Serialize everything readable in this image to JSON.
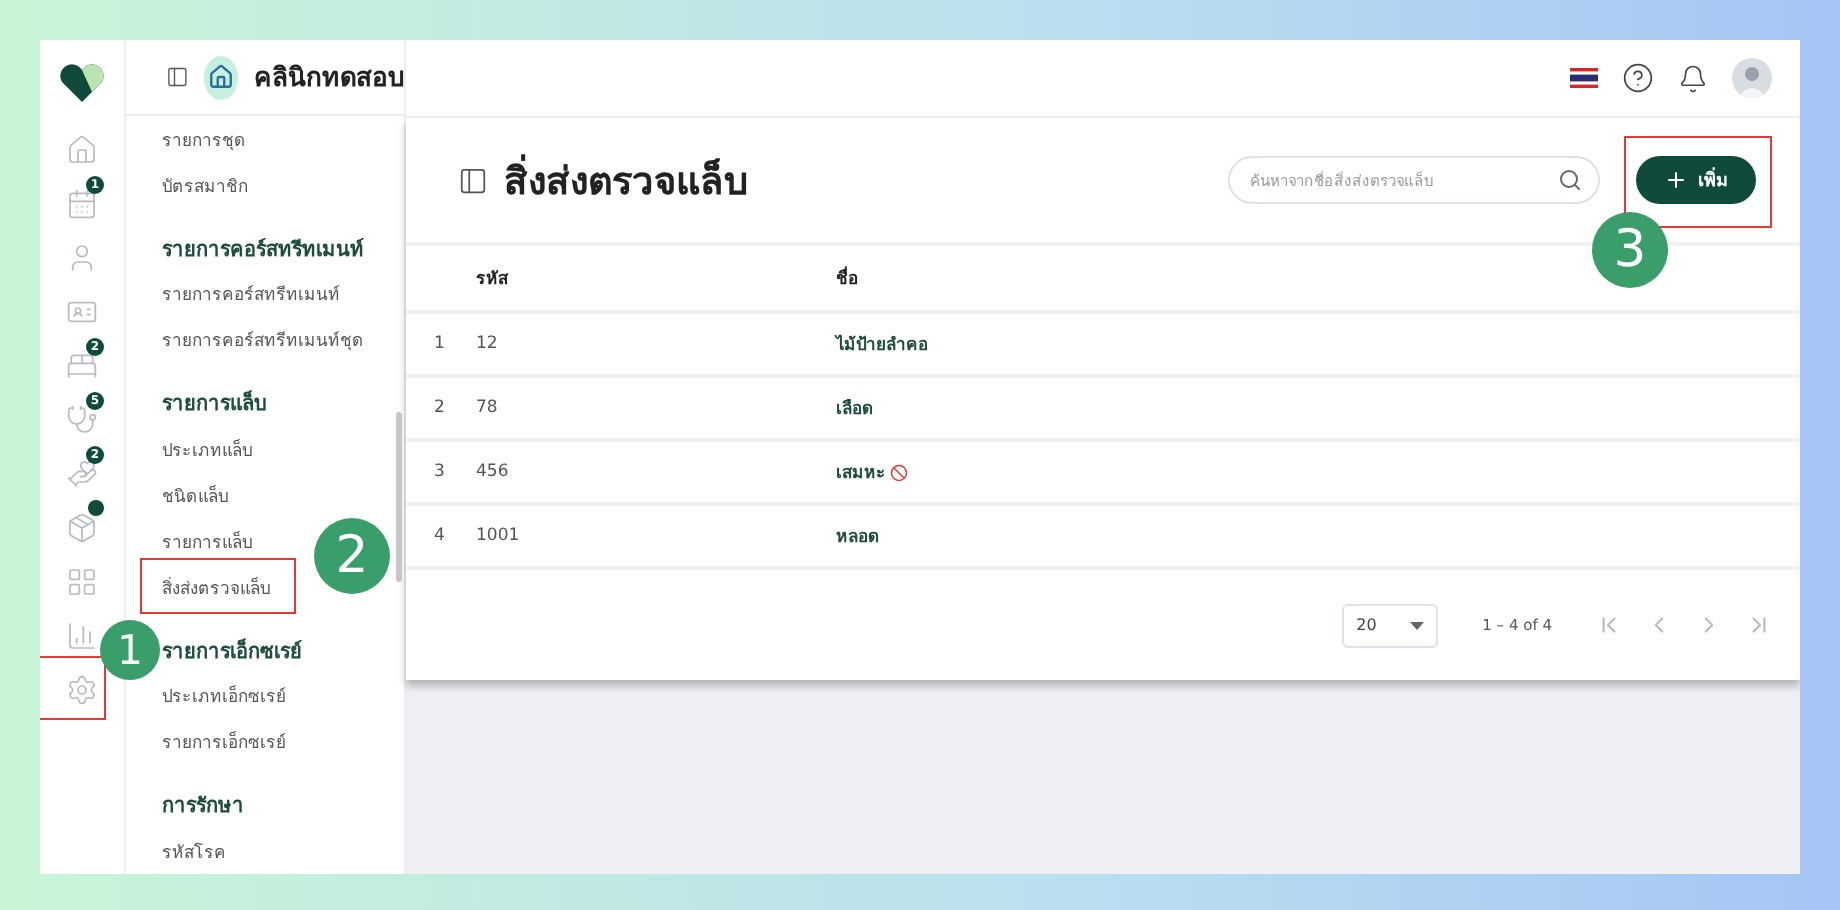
{
  "rail": {
    "items": [
      {
        "kind": "home"
      },
      {
        "kind": "calendar",
        "badge": "1"
      },
      {
        "kind": "person"
      },
      {
        "kind": "card"
      },
      {
        "kind": "bed",
        "badge": "2"
      },
      {
        "kind": "stethoscope",
        "badge": "5"
      },
      {
        "kind": "hand",
        "badge": "2"
      },
      {
        "kind": "box",
        "dot": true
      },
      {
        "kind": "grid"
      },
      {
        "kind": "chart"
      },
      {
        "kind": "settings",
        "annotation": {
          "step": "1"
        }
      }
    ]
  },
  "header": {
    "clinic": "คลินิกทดสอบ"
  },
  "sidebar": {
    "groups": [
      {
        "items": [
          {
            "label": "รายการชุด"
          },
          {
            "label": "บัตรสมาชิก"
          }
        ]
      },
      {
        "heading": "รายการคอร์สทรีทเมนท์",
        "items": [
          {
            "label": "รายการคอร์สทรีทเมนท์"
          },
          {
            "label": "รายการคอร์สทรีทเมนท์ชุด"
          }
        ]
      },
      {
        "heading": "รายการแล็บ",
        "items": [
          {
            "label": "ประเภทแล็บ"
          },
          {
            "label": "ชนิดแล็บ"
          },
          {
            "label": "รายการแล็บ"
          },
          {
            "label": "สิ่งส่งตรวจแล็บ",
            "annotation": {
              "step": "2"
            }
          }
        ]
      },
      {
        "heading": "รายการเอ็กซเรย์",
        "items": [
          {
            "label": "ประเภทเอ็กซเรย์"
          },
          {
            "label": "รายการเอ็กซเรย์"
          }
        ]
      },
      {
        "heading": "การรักษา",
        "items": [
          {
            "label": "รหัสโรค"
          }
        ]
      }
    ]
  },
  "page": {
    "title": "สิ่งส่งตรวจแล็บ",
    "search": {
      "placeholder": "ค้นหาจากชื่อสิ่งส่งตรวจแล็บ"
    },
    "add_button": {
      "label": "เพิ่ม",
      "annotation": {
        "step": "3"
      }
    }
  },
  "table": {
    "columns": [
      "รหัส",
      "ชื่อ"
    ],
    "rows": [
      {
        "index": "1",
        "code": "12",
        "name": "ไม้ป้ายลำคอ",
        "blocked": false
      },
      {
        "index": "2",
        "code": "78",
        "name": "เลือด",
        "blocked": false
      },
      {
        "index": "3",
        "code": "456",
        "name": "เสมหะ",
        "blocked": true
      },
      {
        "index": "4",
        "code": "1001",
        "name": "หลอด",
        "blocked": false
      }
    ]
  },
  "pagination": {
    "page_size": "20",
    "range": "1 – 4 of 4"
  }
}
